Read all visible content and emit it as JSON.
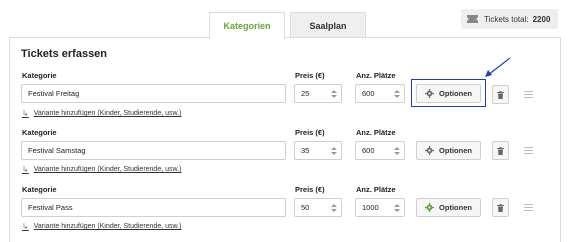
{
  "tabs": [
    {
      "label": "Kategorien",
      "active": true
    },
    {
      "label": "Saalplan",
      "active": false
    }
  ],
  "tickets_total": {
    "label": "Tickets total:",
    "value": "2200"
  },
  "section_title": "Tickets erfassen",
  "labels": {
    "category": "Kategorie",
    "price": "Preis (€)",
    "seats": "Anz. Plätze"
  },
  "options_label": "Optionen",
  "variant_link": "Variante hinzufügen (Kinder, Studierende, usw.)",
  "rows": [
    {
      "category": "Festival Freitag",
      "price": "25",
      "seats": "600",
      "options_highlighted": true
    },
    {
      "category": "Festival Samstag",
      "price": "35",
      "seats": "600",
      "options_highlighted": false
    },
    {
      "category": "Festival Pass",
      "price": "50",
      "seats": "1000",
      "options_highlighted": false
    }
  ],
  "colors": {
    "accent_green": "#6aa535",
    "highlight_blue": "#1a3fc4",
    "gear_gray": "#666666",
    "gear_green": "#5a9e2e"
  }
}
